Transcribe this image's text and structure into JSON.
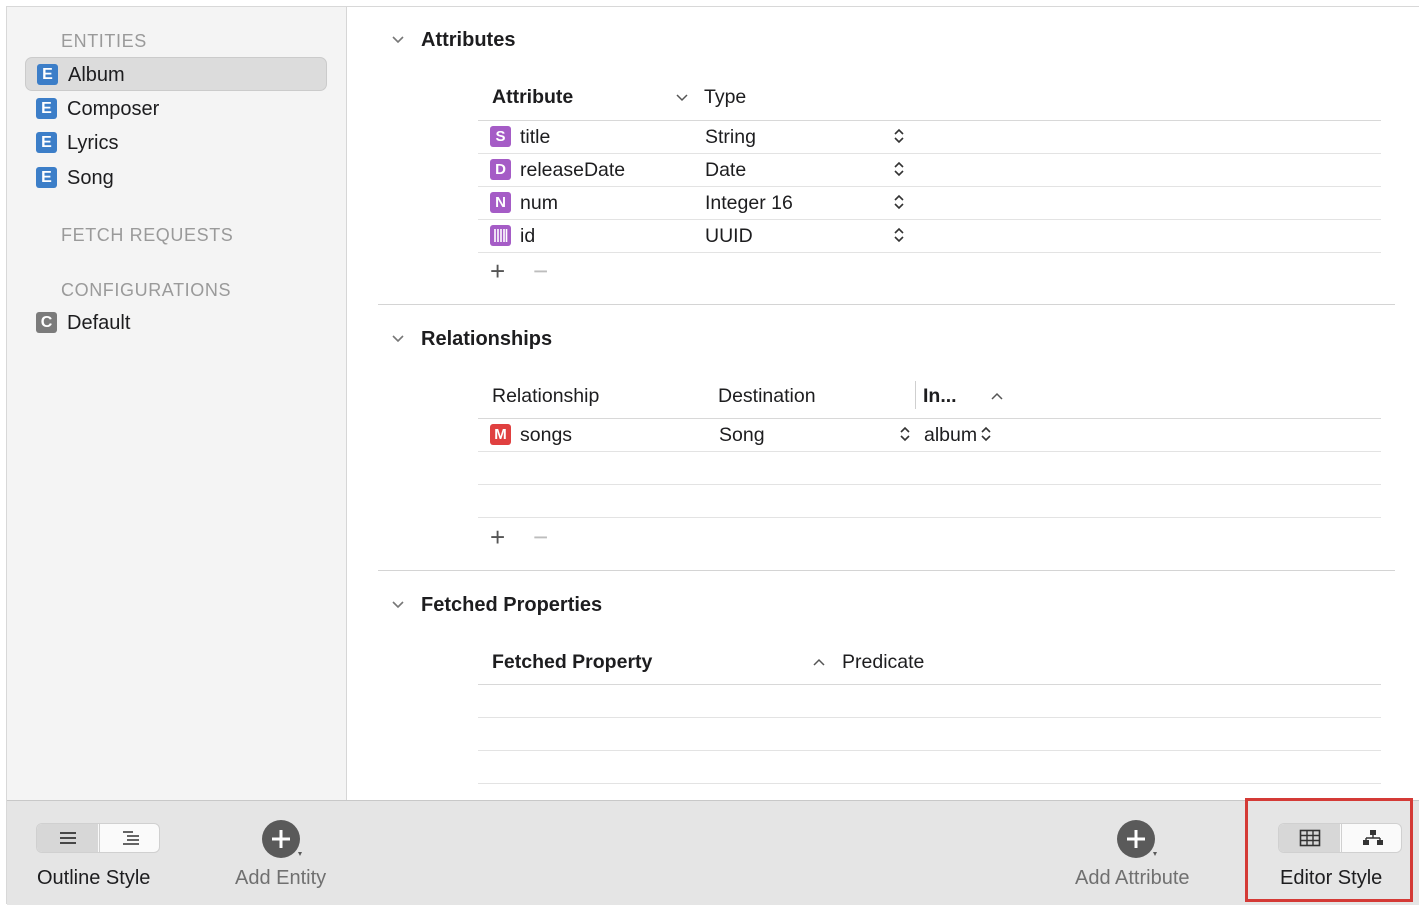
{
  "sidebar": {
    "entities_header": "ENTITIES",
    "entities": [
      {
        "badge": "E",
        "label": "Album",
        "selected": true
      },
      {
        "badge": "E",
        "label": "Composer"
      },
      {
        "badge": "E",
        "label": "Lyrics"
      },
      {
        "badge": "E",
        "label": "Song"
      }
    ],
    "fetch_requests_header": "FETCH REQUESTS",
    "configurations_header": "CONFIGURATIONS",
    "configurations": [
      {
        "badge": "C",
        "label": "Default"
      }
    ]
  },
  "attributes": {
    "title": "Attributes",
    "col_attribute": "Attribute",
    "col_type": "Type",
    "rows": [
      {
        "badge": "S",
        "name": "title",
        "type": "String"
      },
      {
        "badge": "D",
        "name": "releaseDate",
        "type": "Date"
      },
      {
        "badge": "N",
        "name": "num",
        "type": "Integer 16"
      },
      {
        "badge": "",
        "badge_icon": "barcode-icon",
        "name": "id",
        "type": "UUID"
      }
    ],
    "add": "+",
    "remove": "−"
  },
  "relationships": {
    "title": "Relationships",
    "col_relationship": "Relationship",
    "col_destination": "Destination",
    "col_inverse": "In...",
    "rows": [
      {
        "badge": "M",
        "name": "songs",
        "destination": "Song",
        "inverse": "album"
      }
    ],
    "add": "+",
    "remove": "−"
  },
  "fetched_properties": {
    "title": "Fetched Properties",
    "col_property": "Fetched Property",
    "col_predicate": "Predicate"
  },
  "bottombar": {
    "outline_style_label": "Outline Style",
    "add_entity_label": "Add Entity",
    "add_attribute_label": "Add Attribute",
    "editor_style_label": "Editor Style"
  },
  "colors": {
    "entity_badge": "#3c7ec8",
    "attribute_badge": "#a55cc6",
    "relationship_badge": "#e04040",
    "highlight": "#d43a36"
  }
}
